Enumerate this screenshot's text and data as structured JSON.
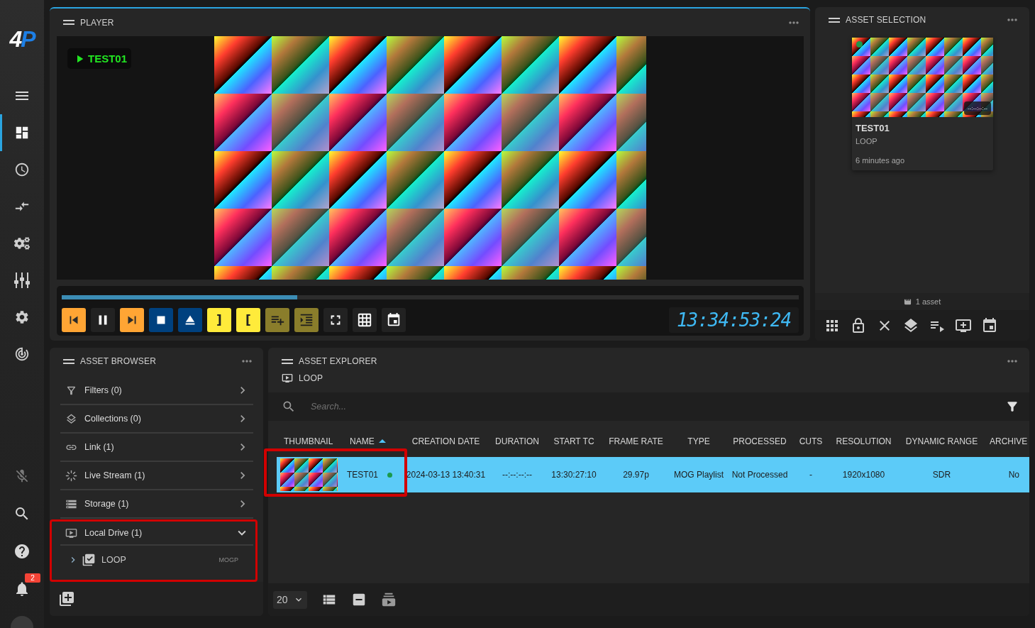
{
  "nav": {
    "logo": "4P",
    "items": [
      {
        "selected": true
      },
      {
        "selected": false
      },
      {
        "selected": false
      },
      {
        "selected": false
      },
      {
        "selected": false
      },
      {
        "selected": false
      },
      {
        "selected": false
      }
    ],
    "notifications": {
      "badge": "2"
    }
  },
  "player": {
    "title": "PLAYER",
    "now_playing": "TEST01",
    "progress": {
      "level": 0.32
    },
    "controls": [
      {
        "kind": "skip-back"
      },
      {
        "kind": "pause"
      },
      {
        "kind": "skip-forward"
      },
      {
        "kind": "stop"
      },
      {
        "kind": "eject"
      },
      {
        "kind": "mark-out",
        "label": "]"
      },
      {
        "kind": "mark-in",
        "label": "["
      },
      {
        "kind": "playlist-add"
      },
      {
        "kind": "indent"
      },
      {
        "kind": "fullscreen"
      },
      {
        "kind": "grid"
      },
      {
        "kind": "calendar"
      }
    ],
    "timecode": "13:34:53:24"
  },
  "asset_selection": {
    "title": "ASSET SELECTION",
    "assets": [
      {
        "name": "TEST01",
        "collection": "LOOP",
        "age": "6 minutes ago",
        "duration": "--:--:--:--",
        "online": true
      }
    ],
    "count": "1 asset"
  },
  "asset_browser": {
    "title": "ASSET BROWSER",
    "sections": [
      {
        "kind": "filters",
        "label": "Filters (0)",
        "expanded": false,
        "highlighted": false
      },
      {
        "kind": "collections",
        "label": "Collections (0)",
        "expanded": false,
        "highlighted": false
      },
      {
        "kind": "link",
        "label": "Link (1)",
        "expanded": false,
        "highlighted": false
      },
      {
        "kind": "live-stream",
        "label": "Live Stream (1)",
        "expanded": false,
        "highlighted": false
      },
      {
        "kind": "storage",
        "label": "Storage (1)",
        "expanded": false,
        "highlighted": false
      },
      {
        "kind": "local-drive",
        "label": "Local Drive (1)",
        "expanded": true,
        "highlighted": true,
        "children": [
          {
            "label": "LOOP",
            "tag": "MOGP",
            "expanded": false
          }
        ]
      }
    ]
  },
  "asset_explorer": {
    "title": "ASSET EXPLORER",
    "location": "LOOP",
    "search": {
      "placeholder": "Search..."
    },
    "columns": [
      {
        "label": "THUMBNAIL",
        "sorted": false
      },
      {
        "label": "NAME",
        "sorted": true
      },
      {
        "label": "CREATION DATE",
        "sorted": false
      },
      {
        "label": "DURATION",
        "sorted": false
      },
      {
        "label": "START TC",
        "sorted": false
      },
      {
        "label": "FRAME RATE",
        "sorted": false
      },
      {
        "label": "TYPE",
        "sorted": false
      },
      {
        "label": "PROCESSED",
        "sorted": false
      },
      {
        "label": "CUTS",
        "sorted": false
      },
      {
        "label": "RESOLUTION",
        "sorted": false
      },
      {
        "label": "DYNAMIC RANGE",
        "sorted": false
      },
      {
        "label": "ARCHIVE",
        "sorted": false
      }
    ],
    "rows": [
      {
        "selected": true,
        "highlighted": true,
        "online": true,
        "cells": [
          "",
          "TEST01",
          "2024-03-13 13:40:31",
          "--:--:--:--",
          "13:30:27:10",
          "29.97p",
          "MOG Playlist",
          "Not Processed",
          "-",
          "1920x1080",
          "SDR",
          "No"
        ]
      }
    ],
    "page_size": "20"
  }
}
